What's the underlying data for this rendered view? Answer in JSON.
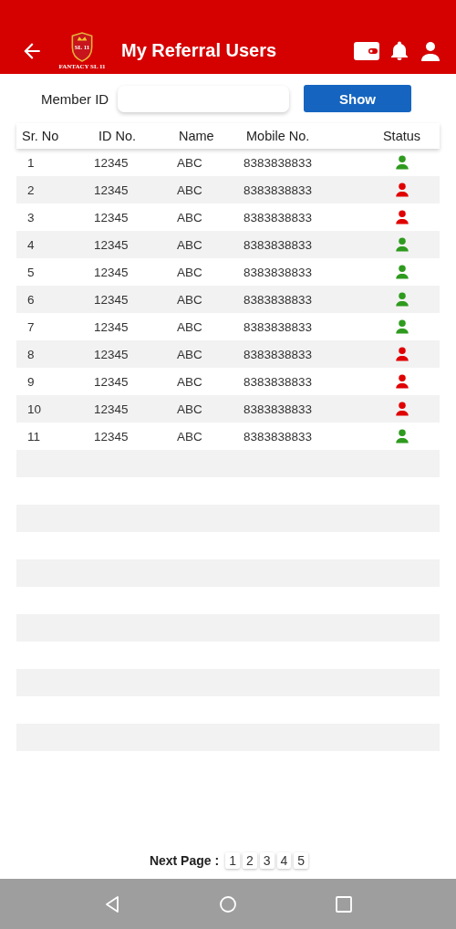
{
  "header": {
    "title": "My Referral Users",
    "logo": {
      "mark": "SL 11",
      "name": "FANTACY SL 11"
    }
  },
  "filter": {
    "label": "Member ID",
    "button": "Show"
  },
  "table": {
    "columns": [
      "Sr. No",
      "ID No.",
      "Name",
      "Mobile No.",
      "Status"
    ],
    "rows": [
      {
        "sr": "1",
        "id": "12345",
        "name": "ABC",
        "mobile": "8383838833",
        "active": true
      },
      {
        "sr": "2",
        "id": "12345",
        "name": "ABC",
        "mobile": "8383838833",
        "active": false
      },
      {
        "sr": "3",
        "id": "12345",
        "name": "ABC",
        "mobile": "8383838833",
        "active": false
      },
      {
        "sr": "4",
        "id": "12345",
        "name": "ABC",
        "mobile": "8383838833",
        "active": true
      },
      {
        "sr": "5",
        "id": "12345",
        "name": "ABC",
        "mobile": "8383838833",
        "active": true
      },
      {
        "sr": "6",
        "id": "12345",
        "name": "ABC",
        "mobile": "8383838833",
        "active": true
      },
      {
        "sr": "7",
        "id": "12345",
        "name": "ABC",
        "mobile": "8383838833",
        "active": true
      },
      {
        "sr": "8",
        "id": "12345",
        "name": "ABC",
        "mobile": "8383838833",
        "active": false
      },
      {
        "sr": "9",
        "id": "12345",
        "name": "ABC",
        "mobile": "8383838833",
        "active": false
      },
      {
        "sr": "10",
        "id": "12345",
        "name": "ABC",
        "mobile": "8383838833",
        "active": false
      },
      {
        "sr": "11",
        "id": "12345",
        "name": "ABC",
        "mobile": "8383838833",
        "active": true
      }
    ]
  },
  "pagination": {
    "label": "Next Page :",
    "pages": [
      "1",
      "2",
      "3",
      "4",
      "5"
    ]
  }
}
